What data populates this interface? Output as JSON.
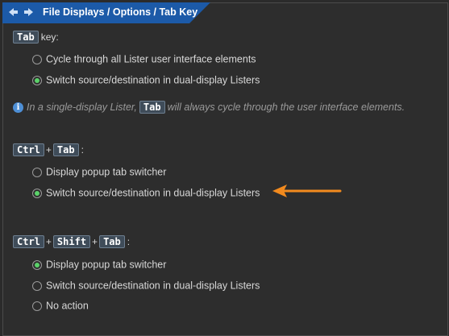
{
  "header": {
    "back_icon": "arrow-left-icon",
    "forward_icon": "arrow-right-icon",
    "title": "File Displays / Options / Tab Key"
  },
  "sections": {
    "tab": {
      "keys": [
        "Tab"
      ],
      "suffix": "key:",
      "options": [
        {
          "label": "Cycle through all Lister user interface elements",
          "selected": false
        },
        {
          "label": "Switch source/destination in dual-display Listers",
          "selected": true
        }
      ]
    },
    "info": {
      "icon": "info-icon",
      "text_before": "In a single-display Lister,",
      "key": "Tab",
      "text_after": "will always cycle through the user interface elements."
    },
    "ctrl_tab": {
      "keys": [
        "Ctrl",
        "Tab"
      ],
      "suffix": ":",
      "options": [
        {
          "label": "Display popup tab switcher",
          "selected": false
        },
        {
          "label": "Switch source/destination in dual-display Listers",
          "selected": true
        }
      ]
    },
    "ctrl_shift_tab": {
      "keys": [
        "Ctrl",
        "Shift",
        "Tab"
      ],
      "suffix": ":",
      "options": [
        {
          "label": "Display popup tab switcher",
          "selected": true
        },
        {
          "label": "Switch source/destination in dual-display Listers",
          "selected": false
        },
        {
          "label": "No action",
          "selected": false
        }
      ]
    }
  },
  "separator": "+",
  "colors": {
    "header_bg": "#1c5aa8",
    "radio_selected": "#5bd26a",
    "annotation_arrow": "#f28a1e"
  },
  "annotation": {
    "icon": "arrow-left-annotation-icon"
  }
}
